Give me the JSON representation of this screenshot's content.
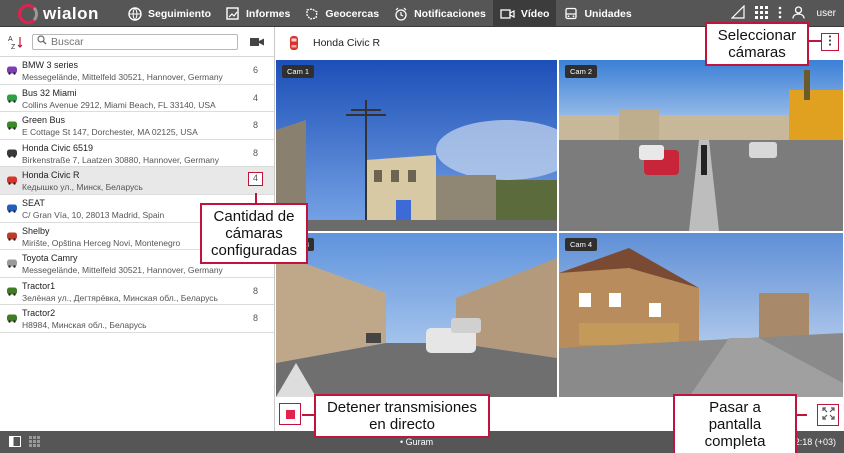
{
  "app": {
    "logo_text": "wialon"
  },
  "nav": {
    "items": [
      {
        "label": "Seguimiento",
        "icon": "globe-icon"
      },
      {
        "label": "Informes",
        "icon": "report-icon"
      },
      {
        "label": "Geocercas",
        "icon": "geofence-icon"
      },
      {
        "label": "Notificaciones",
        "icon": "alarm-icon"
      },
      {
        "label": "Vídeo",
        "icon": "video-icon",
        "active": true
      },
      {
        "label": "Unidades",
        "icon": "bus-icon"
      }
    ],
    "user_label": "user"
  },
  "sidebar": {
    "search_placeholder": "Buscar",
    "units": [
      {
        "name": "BMW 3 series",
        "address": "Messegelände, Mittelfeld 30521, Hannover, Germany",
        "cameras": "6",
        "icon": "purple-car-icon",
        "color": "#7b3fb5"
      },
      {
        "name": "Bus 32 Miami",
        "address": "Collins Avenue 2912, Miami Beach, FL 33140, USA",
        "cameras": "4",
        "icon": "green-a-icon",
        "color": "#2ea043"
      },
      {
        "name": "Green Bus",
        "address": "E Cottage St 147, Dorchester, MA 02125, USA",
        "cameras": "8",
        "icon": "green-bus-icon",
        "color": "#3a8a2a"
      },
      {
        "name": "Honda Civic 6519",
        "address": "Birkenstraße 7, Laatzen 30880, Hannover, Germany",
        "cameras": "8",
        "icon": "dark-car-icon",
        "color": "#3a3a3a"
      },
      {
        "name": "Honda Civic R",
        "address": "Кедышко ул., Минск, Беларусь",
        "cameras": "4",
        "icon": "red-car-icon",
        "color": "#d9342b",
        "selected": true
      },
      {
        "name": "SEAT",
        "address": "C/ Gran Vía, 10, 28013 Madrid, Spain",
        "cameras": "",
        "icon": "blue-car-icon",
        "color": "#1f5fbf"
      },
      {
        "name": "Shelby",
        "address": "Mirište, Opština Herceg Novi, Montenegro",
        "cameras": "",
        "icon": "red-sports-car-icon",
        "color": "#c0392b"
      },
      {
        "name": "Toyota Camry",
        "address": "Messegelände, Mittelfeld 30521, Hannover, Germany",
        "cameras": "",
        "icon": "grey-car-icon",
        "color": "#9a9a9a"
      },
      {
        "name": "Tractor1",
        "address": "Зелёная ул., Дегтярёвка, Минская обл., Беларусь",
        "cameras": "8",
        "icon": "tractor-icon",
        "color": "#3f7d22"
      },
      {
        "name": "Tractor2",
        "address": "H8984, Минская обл., Беларусь",
        "cameras": "8",
        "icon": "tractor-icon",
        "color": "#3f7d22"
      }
    ]
  },
  "main": {
    "title": "Honda Civic R",
    "cameras": [
      {
        "label": "Cam 1"
      },
      {
        "label": "Cam 2"
      },
      {
        "label": "Cam 3"
      },
      {
        "label": "Cam 4"
      }
    ]
  },
  "bottombar": {
    "center_text": "• Guram",
    "time": "10:32:18 (+03)"
  },
  "callouts": {
    "select_cameras": "Seleccionar cámaras",
    "camera_count": "Cantidad de cámaras configuradas",
    "stop_streams": "Detener transmisiones en directo",
    "fullscreen": "Pasar a pantalla completa"
  },
  "colors": {
    "accent": "#c0143c",
    "topbar": "#565656"
  }
}
